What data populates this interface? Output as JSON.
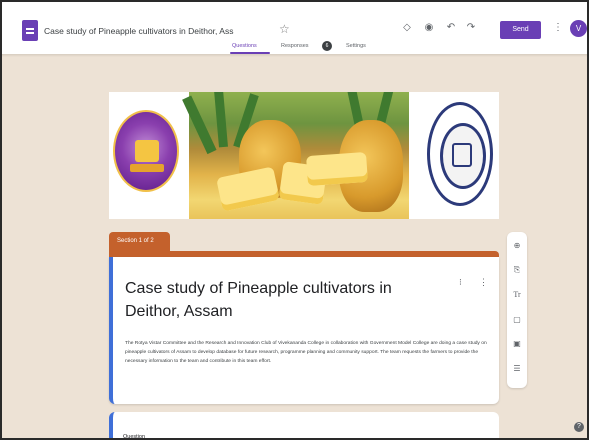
{
  "header": {
    "title": "Case study of Pineapple cultivators in Deithor, Ass",
    "send_label": "Send",
    "avatar_letter": "V",
    "icons": [
      "palette-icon",
      "preview-icon",
      "undo-icon",
      "redo-icon",
      "more-vert-icon"
    ]
  },
  "tabs": {
    "questions": "Questions",
    "responses": "Responses",
    "responses_count": "6",
    "settings": "Settings"
  },
  "section": {
    "label": "Section 1 of 2"
  },
  "form": {
    "title": "Case study of Pineapple cultivators in Deithor, Assam",
    "description": "The Rotya Vistar Committee and the Research and Innovation Club of Vivekananda College in collaboration with Government Model College are doing a case study on pineapple cultivators of Assam to develop database for future research, programme planning and community support. The team requests the farmers to provide the necessary information to the team and contribute in this team effort."
  },
  "side_toolbar": {
    "icons": [
      "add-question-icon",
      "import-questions-icon",
      "add-title-icon",
      "add-image-icon",
      "add-video-icon",
      "add-section-icon"
    ]
  },
  "question": {
    "label": "Question"
  },
  "colors": {
    "accent": "#6a3fb5",
    "section": "#c4612c",
    "card_edge": "#3f6fd8",
    "background": "#ede2d5"
  }
}
